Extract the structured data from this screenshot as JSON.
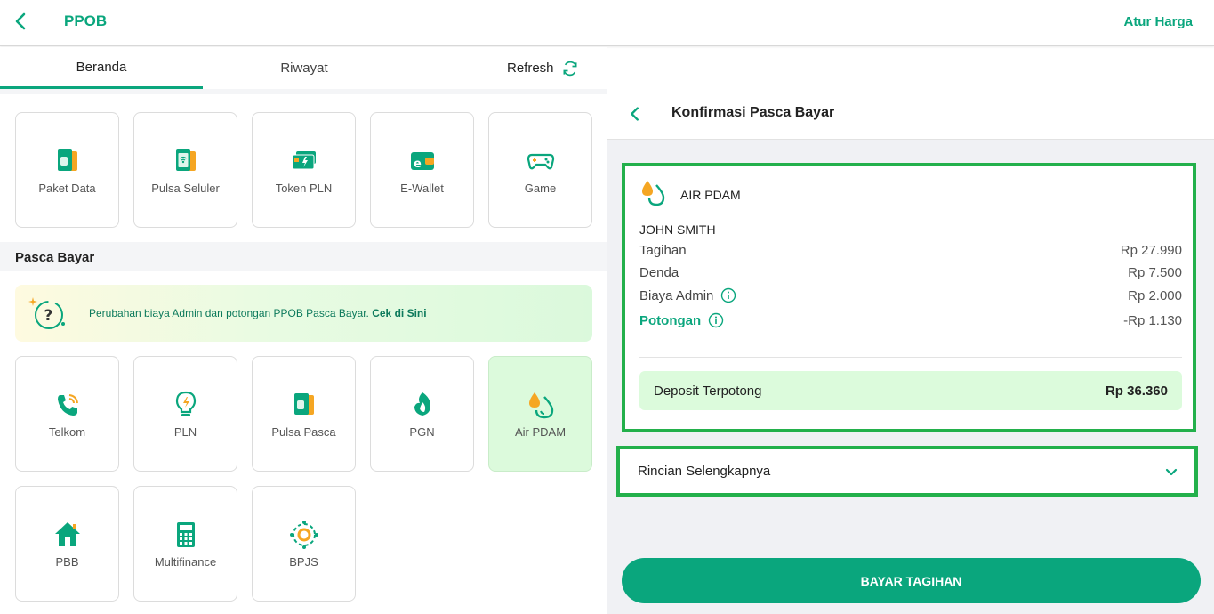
{
  "header": {
    "title": "PPOB",
    "action_label": "Atur Harga"
  },
  "tabs": {
    "beranda": "Beranda",
    "riwayat": "Riwayat",
    "refresh": "Refresh"
  },
  "prabayar": {
    "items": [
      {
        "label": "Paket Data",
        "icon": "sim-card-icon"
      },
      {
        "label": "Pulsa Seluler",
        "icon": "phone-signal-icon"
      },
      {
        "label": "Token PLN",
        "icon": "electric-card-icon"
      },
      {
        "label": "E-Wallet",
        "icon": "wallet-icon"
      },
      {
        "label": "Game",
        "icon": "gamepad-icon"
      }
    ]
  },
  "pasca": {
    "title": "Pasca Bayar",
    "notice_text": "Perubahan biaya Admin dan potongan PPOB Pasca Bayar. ",
    "notice_link": "Cek di Sini",
    "items": [
      {
        "label": "Telkom",
        "icon": "telephone-icon"
      },
      {
        "label": "PLN",
        "icon": "lightbulb-icon"
      },
      {
        "label": "Pulsa Pasca",
        "icon": "sim-card-icon"
      },
      {
        "label": "PGN",
        "icon": "gas-flame-icon"
      },
      {
        "label": "Air PDAM",
        "icon": "water-drop-icon",
        "selected": true
      },
      {
        "label": "PBB",
        "icon": "house-icon"
      },
      {
        "label": "Multifinance",
        "icon": "calculator-icon"
      },
      {
        "label": "BPJS",
        "icon": "bpjs-icon"
      }
    ]
  },
  "confirm": {
    "title": "Konfirmasi Pasca Bayar",
    "provider": "AIR PDAM",
    "customer": "JOHN SMITH",
    "rows": {
      "tagihan": {
        "label": "Tagihan",
        "value": "Rp 27.990"
      },
      "denda": {
        "label": "Denda",
        "value": "Rp 7.500"
      },
      "admin": {
        "label": "Biaya Admin",
        "value": "Rp 2.000"
      },
      "potongan": {
        "label": "Potongan",
        "value": "-Rp 1.130"
      }
    },
    "deposit": {
      "label": "Deposit Terpotong",
      "value": "Rp 36.360"
    },
    "details_label": "Rincian Selengkapnya",
    "pay_label": "BAYAR TAGIHAN"
  },
  "colors": {
    "accent": "#0aa67d",
    "highlight_border": "#23b04b",
    "orange": "#f5a623"
  }
}
